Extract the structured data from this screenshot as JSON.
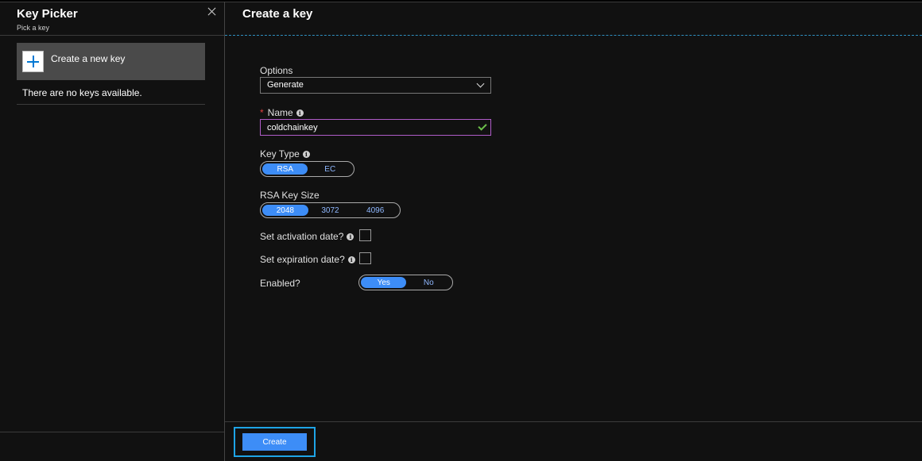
{
  "key_picker": {
    "title": "Key Picker",
    "subtitle": "Pick a key",
    "create_new_key_label": "Create a new key",
    "empty_message": "There are no keys available."
  },
  "create_key": {
    "title": "Create a key",
    "options": {
      "label": "Options",
      "value": "Generate"
    },
    "name": {
      "label": "Name",
      "required_marker": "*",
      "value": "coldchainkey"
    },
    "key_type": {
      "label": "Key Type",
      "options": [
        "RSA",
        "EC"
      ],
      "selected": "RSA"
    },
    "rsa_key_size": {
      "label": "RSA Key Size",
      "options": [
        "2048",
        "3072",
        "4096"
      ],
      "selected": "2048"
    },
    "activation_date": {
      "label": "Set activation date?",
      "checked": false
    },
    "expiration_date": {
      "label": "Set expiration date?",
      "checked": false
    },
    "enabled": {
      "label": "Enabled?",
      "options": [
        "Yes",
        "No"
      ],
      "selected": "Yes"
    },
    "create_button": "Create",
    "info_glyph": "i"
  },
  "colors": {
    "accent": "#3d8df7",
    "focus": "#1ea4e6",
    "valid": "#6cc04a",
    "required": "#e04040",
    "input_border_active": "#b05cc8"
  }
}
